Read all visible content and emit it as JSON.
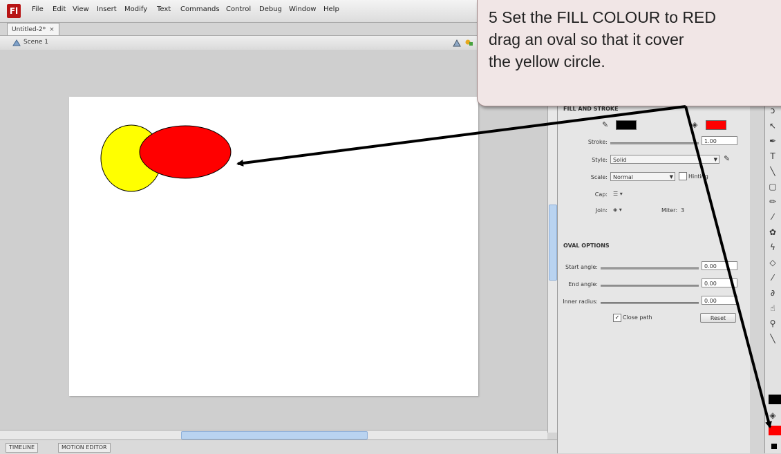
{
  "app": {
    "logo_letter": "Fl"
  },
  "menu": [
    {
      "label": "File"
    },
    {
      "label": "Edit"
    },
    {
      "label": "View"
    },
    {
      "label": "Insert"
    },
    {
      "label": "Modify"
    },
    {
      "label": "Text"
    },
    {
      "label": "Commands"
    },
    {
      "label": "Control"
    },
    {
      "label": "Debug"
    },
    {
      "label": "Window"
    },
    {
      "label": "Help"
    }
  ],
  "document_tab": {
    "label": "Untitled-2*",
    "close": "×"
  },
  "scene": {
    "label": "Scene 1"
  },
  "stage": {
    "shapes": [
      {
        "name": "yellow-circle",
        "fill": "#ffff00",
        "stroke": "#000000"
      },
      {
        "name": "red-oval",
        "fill": "#ff0000",
        "stroke": "#000000"
      }
    ]
  },
  "properties": {
    "fill_stroke_header": "FILL AND STROKE",
    "stroke_color": "#000000",
    "fill_color": "#ff0000",
    "stroke_label": "Stroke:",
    "stroke_value": "1.00",
    "style_label": "Style:",
    "style_value": "Solid",
    "scale_label": "Scale:",
    "scale_value": "Normal",
    "hinting_label": "Hinting",
    "cap_label": "Cap:",
    "join_label": "Join:",
    "miter_label": "Miter:",
    "miter_value": "3",
    "oval_options_header": "OVAL OPTIONS",
    "start_angle_label": "Start angle:",
    "start_angle_value": "0.00",
    "end_angle_label": "End angle:",
    "end_angle_value": "0.00",
    "inner_radius_label": "Inner radius:",
    "inner_radius_value": "0.00",
    "close_path_label": "Close path",
    "reset_label": "Reset"
  },
  "bottom_tabs": [
    {
      "label": "TIMELINE"
    },
    {
      "label": "MOTION EDITOR"
    }
  ],
  "callout": {
    "line1": "5 Set the FILL COLOUR to RED",
    "line2": "drag an oval so that it cover",
    "line3": "the yellow circle."
  },
  "colors": {
    "accent_red": "#ff0000",
    "shape_yellow": "#ffff00",
    "callout_bg": "#f1e6e6"
  }
}
